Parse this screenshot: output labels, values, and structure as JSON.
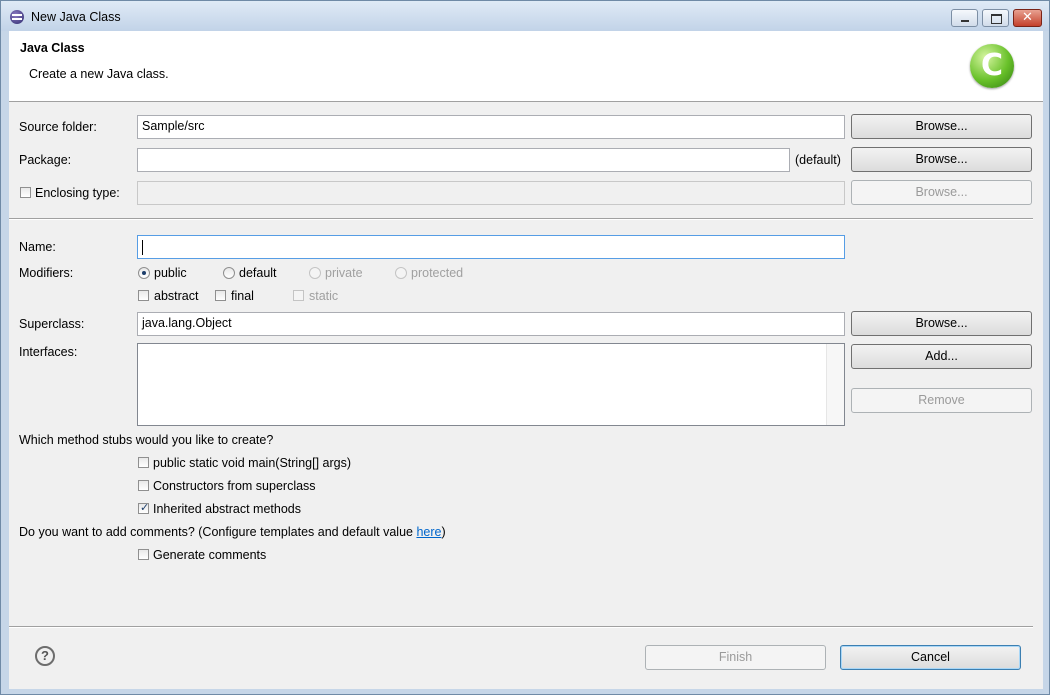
{
  "window": {
    "title": "New Java Class",
    "minimize": "minimize",
    "maximize": "maximize",
    "close": "✕"
  },
  "header": {
    "title": "Java Class",
    "description": "Create a new Java class.",
    "icon_letter": "C"
  },
  "source_folder": {
    "label": "Source folder:",
    "value": "Sample/src",
    "browse": "Browse..."
  },
  "package": {
    "label": "Package:",
    "value": "",
    "default_hint": "(default)",
    "browse": "Browse..."
  },
  "enclosing_type": {
    "label": "Enclosing type:",
    "checked": false,
    "value": "",
    "browse": "Browse..."
  },
  "name": {
    "label": "Name:",
    "value": ""
  },
  "modifiers": {
    "label": "Modifiers:",
    "access": [
      {
        "label": "public",
        "selected": true,
        "enabled": true
      },
      {
        "label": "default",
        "selected": false,
        "enabled": true
      },
      {
        "label": "private",
        "selected": false,
        "enabled": false
      },
      {
        "label": "protected",
        "selected": false,
        "enabled": false
      }
    ],
    "flags": [
      {
        "label": "abstract",
        "checked": false,
        "enabled": true
      },
      {
        "label": "final",
        "checked": false,
        "enabled": true
      },
      {
        "label": "static",
        "checked": false,
        "enabled": false
      }
    ]
  },
  "superclass": {
    "label": "Superclass:",
    "value": "java.lang.Object",
    "browse": "Browse..."
  },
  "interfaces": {
    "label": "Interfaces:",
    "items": [],
    "add": "Add...",
    "remove": "Remove"
  },
  "stubs": {
    "question": "Which method stubs would you like to create?",
    "options": [
      {
        "label": "public static void main(String[] args)",
        "checked": false
      },
      {
        "label": "Constructors from superclass",
        "checked": false
      },
      {
        "label": "Inherited abstract methods",
        "checked": true
      }
    ]
  },
  "comments": {
    "question_prefix": "Do you want to add comments? (Configure templates and default value ",
    "link": "here",
    "question_suffix": ")",
    "generate": {
      "label": "Generate comments",
      "checked": false
    }
  },
  "footer": {
    "help": "?",
    "finish": "Finish",
    "cancel": "Cancel"
  }
}
